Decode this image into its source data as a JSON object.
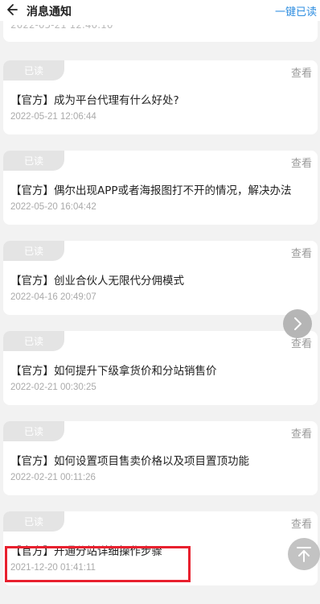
{
  "header": {
    "title": "消息通知",
    "mark_all_label": "一键已读"
  },
  "partial": {
    "date": "2022-05-21 12:40:10"
  },
  "messages": [
    {
      "status": "已读",
      "view_label": "查看",
      "title": "【官方】成为平台代理有什么好处?",
      "date": "2022-05-21 12:06:44"
    },
    {
      "status": "已读",
      "view_label": "查看",
      "title": "【官方】偶尔出现APP或者海报图打不开的情况，解决办法",
      "date": "2022-05-20 16:04:42"
    },
    {
      "status": "已读",
      "view_label": "查看",
      "title": "【官方】创业合伙人无限代分佣模式",
      "date": "2022-04-16 20:49:07"
    },
    {
      "status": "已读",
      "view_label": "查看",
      "title": "【官方】如何提升下级拿货价和分站销售价",
      "date": "2022-02-21 00:30:25"
    },
    {
      "status": "已读",
      "view_label": "查看",
      "title": "【官方】如何设置项目售卖价格以及项目置顶功能",
      "date": "2022-02-21 00:11:26"
    },
    {
      "status": "已读",
      "view_label": "查看",
      "title": "【官方】开通分站详细操作步骤",
      "date": "2021-12-20 01:41:11"
    }
  ]
}
